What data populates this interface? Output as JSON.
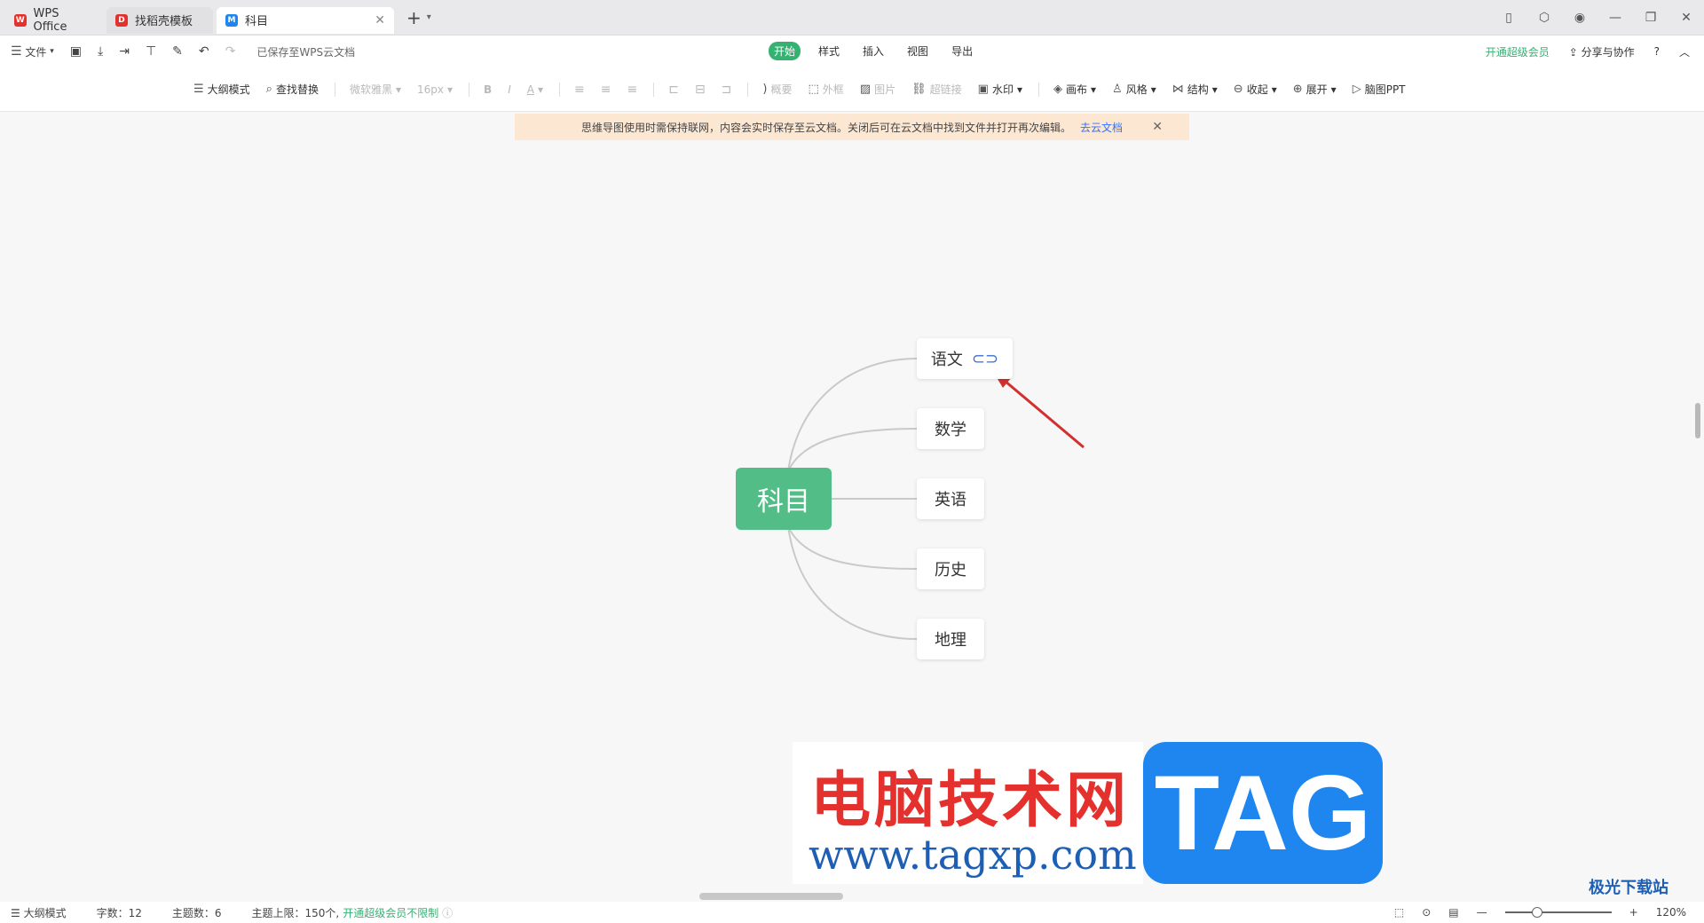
{
  "tabs": [
    {
      "label": "WPS Office",
      "icon": "wps-logo-icon"
    },
    {
      "label": "找稻壳模板",
      "icon": "docer-icon"
    },
    {
      "label": "科目",
      "icon": "mindmap-icon"
    }
  ],
  "menu": {
    "file": "文件",
    "saved_status": "已保存至WPS云文档",
    "tabs": [
      "开始",
      "样式",
      "插入",
      "视图",
      "导出"
    ],
    "active_tab": "开始",
    "vip": "开通超级会员",
    "share": "分享与协作",
    "help": "?"
  },
  "toolbar": {
    "outline": "大纲模式",
    "find_replace": "查找替换",
    "font": "微软雅黑",
    "font_size": "16px",
    "bold": "B",
    "italic": "I",
    "font_color": "A",
    "summary": "概要",
    "frame": "外框",
    "image": "图片",
    "hyperlink": "超链接",
    "watermark": "水印",
    "canvas": "画布",
    "style": "风格",
    "structure": "结构",
    "collapse": "收起",
    "expand": "展开",
    "mindmap_ppt": "脑图PPT"
  },
  "notice": {
    "text": "思维导图使用时需保持联网，内容会实时保存至云文档。关闭后可在云文档中找到文件并打开再次编辑。",
    "link": "去云文档"
  },
  "mindmap": {
    "root": "科目",
    "children": [
      "语文",
      "数学",
      "英语",
      "历史",
      "地理"
    ],
    "linked_child": "语文",
    "root_color": "#52bd87"
  },
  "watermark": {
    "title": "电脑技术网",
    "url": "www.tagxp.com",
    "tag": "TAG",
    "site2": "极光下载站"
  },
  "status": {
    "outline": "大纲模式",
    "word_count": "字数：12",
    "topic_count": "主题数：6",
    "topic_limit": "主题上限：150个,",
    "vip_unlimited": "开通超级会员不限制",
    "zoom": "120%"
  }
}
